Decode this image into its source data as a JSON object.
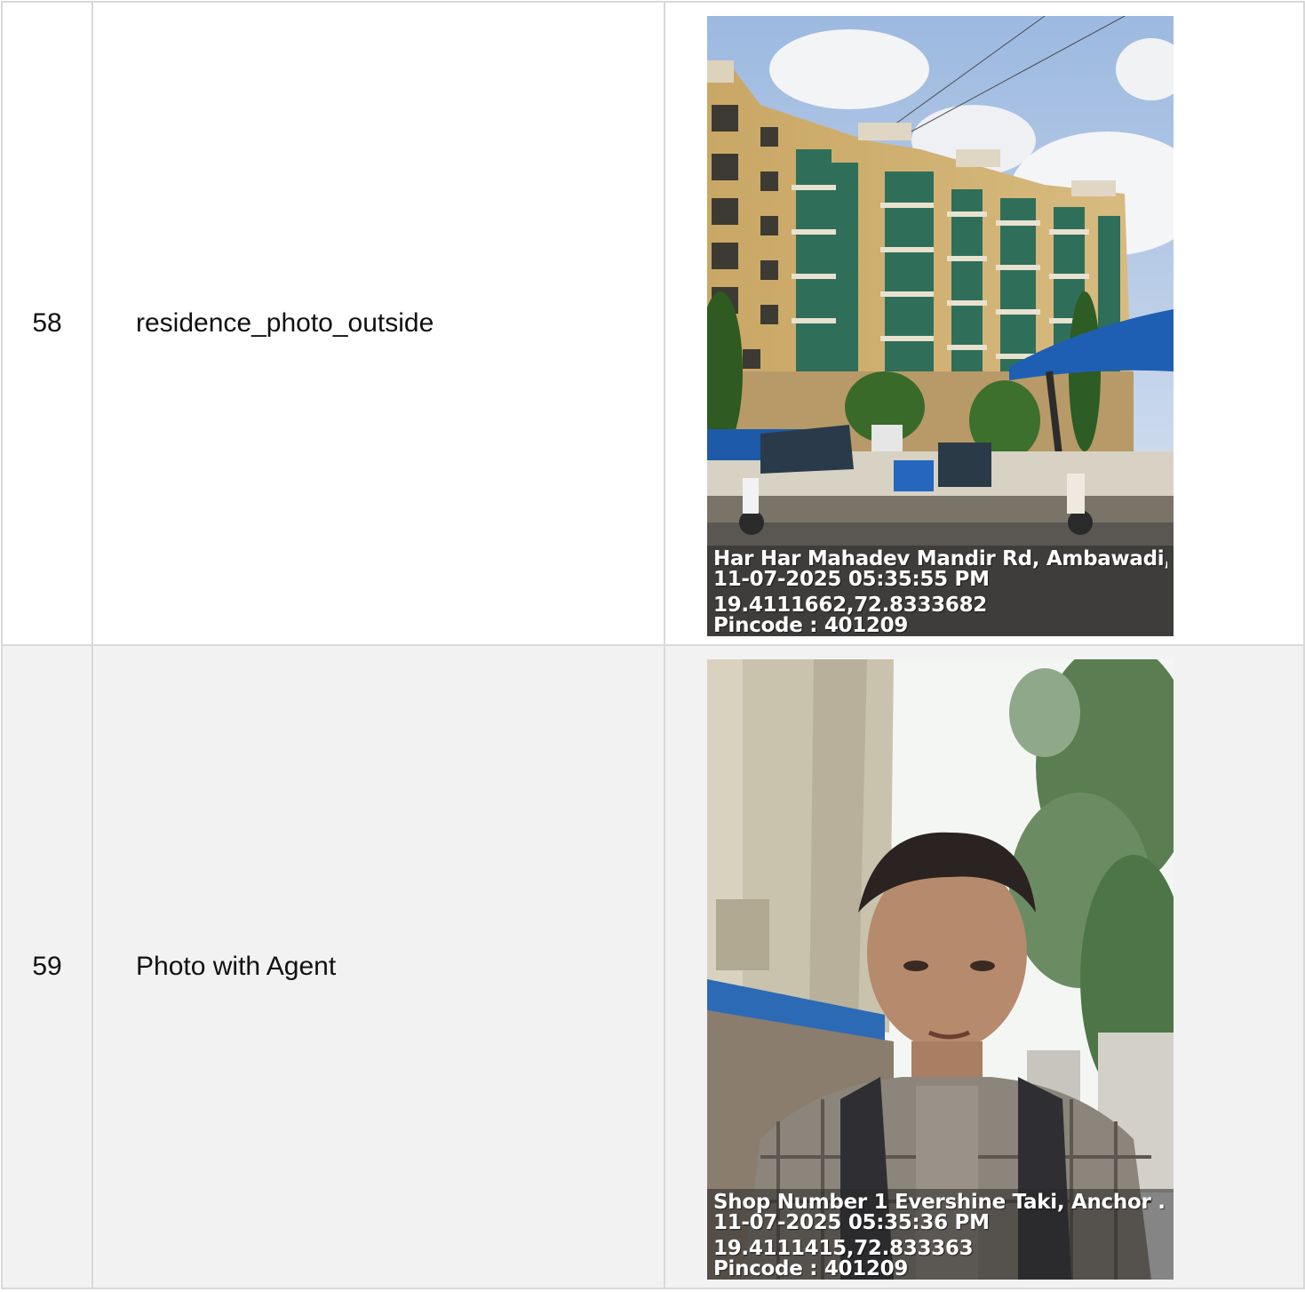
{
  "rows": [
    {
      "number": "58",
      "label": "residence_photo_outside",
      "photo": {
        "subject": "apartment-building-street-photo",
        "stamp": {
          "address": "Har Har Mahadev Mandir Rd, Ambawadi, ...",
          "datetime": "11-07-2025 05:35:55 PM",
          "coordinates": "19.4111662,72.8333682",
          "pincode": "Pincode : 401209"
        }
      }
    },
    {
      "number": "59",
      "label": "Photo with Agent",
      "photo": {
        "subject": "agent-selfie-photo",
        "stamp": {
          "address": "Shop Number 1 Evershine Taki, Anchor ...",
          "datetime": "11-07-2025 05:35:36 PM",
          "coordinates": "19.4111415,72.833363",
          "pincode": "Pincode : 401209"
        }
      }
    }
  ],
  "colors": {
    "border": "#d9d9d9",
    "alt_row_background": "#f2f2f2",
    "text": "#111111"
  }
}
